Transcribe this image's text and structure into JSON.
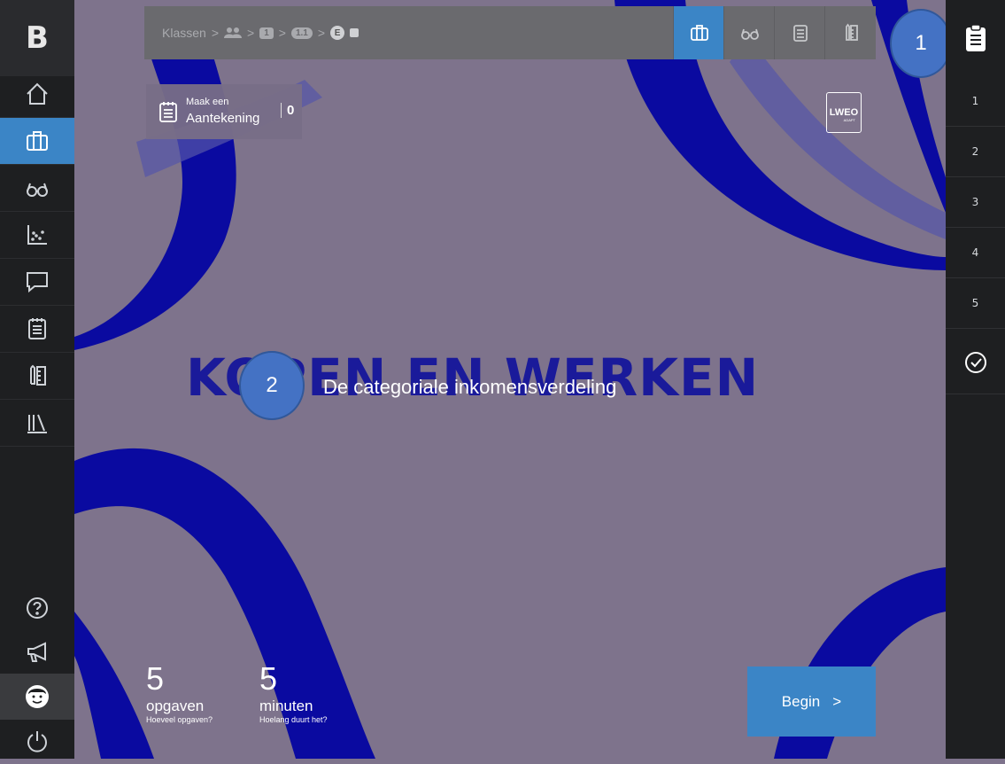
{
  "logo": {
    "text": "B"
  },
  "sidebar": {
    "items": [
      {
        "name": "home-icon"
      },
      {
        "name": "briefcase-icon",
        "active": true
      },
      {
        "name": "glasses-icon"
      },
      {
        "name": "chart-icon"
      },
      {
        "name": "chat-icon"
      },
      {
        "name": "notepad-icon"
      },
      {
        "name": "ruler-pencil-icon"
      },
      {
        "name": "library-icon"
      }
    ],
    "bottom": [
      {
        "name": "help-icon"
      },
      {
        "name": "megaphone-icon"
      },
      {
        "name": "avatar-icon"
      },
      {
        "name": "power-icon"
      }
    ]
  },
  "breadcrumb": {
    "root": "Klassen",
    "sep": ">",
    "level1": "1",
    "level2": "1.1",
    "level3": "E"
  },
  "toolbar": {
    "tools": [
      "briefcase-icon",
      "glasses-icon",
      "notepad-icon",
      "ruler-pencil-icon"
    ]
  },
  "note": {
    "line1": "Maak een",
    "line2": "Aantekening",
    "count": "0"
  },
  "brand": {
    "name": "LWEO",
    "sub": "ADAPT"
  },
  "title": {
    "main": "KOPEN EN WERKEN",
    "sub": "De categoriale inkomensverdeling"
  },
  "badges": {
    "one": "1",
    "two": "2"
  },
  "stats": [
    {
      "number": "5",
      "label": "opgaven",
      "hint": "Hoeveel opgaven?"
    },
    {
      "number": "5",
      "label": "minuten",
      "hint": "Hoelang duurt het?"
    }
  ],
  "begin": {
    "label": "Begin",
    "arrow": ">"
  },
  "right": {
    "steps": [
      "1",
      "2",
      "3",
      "4",
      "5"
    ]
  },
  "colors": {
    "accent": "#3b85c6",
    "background": "#7e738c",
    "ribbon": "#0a0aa0"
  }
}
